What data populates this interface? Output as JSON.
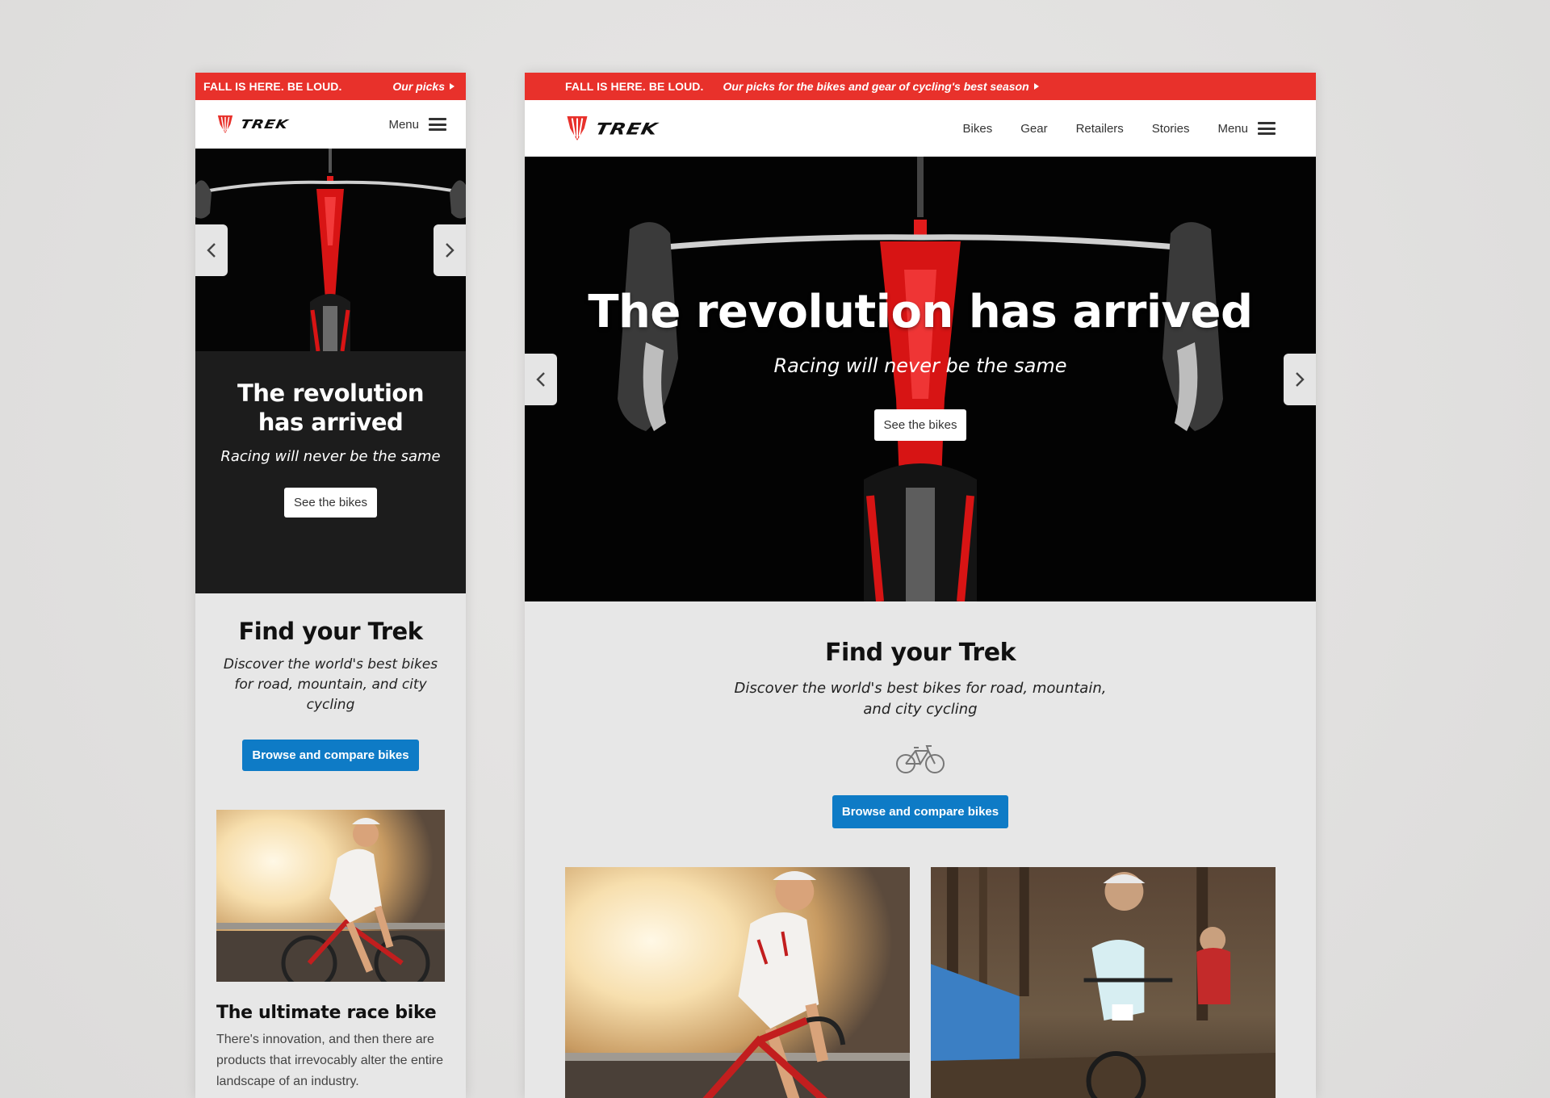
{
  "promo": {
    "lead": "FALL IS HERE. BE LOUD.",
    "link_short": "Our picks",
    "link_long": "Our picks for the bikes and gear of cycling's best season"
  },
  "brand": {
    "name": "TREK",
    "accent": "#e8312b",
    "button_blue": "#0e7bc6"
  },
  "nav": {
    "links": [
      "Bikes",
      "Gear",
      "Retailers",
      "Stories"
    ],
    "menu_label": "Menu"
  },
  "hero": {
    "title": "The revolution has arrived",
    "subtitle": "Racing will never be the same",
    "cta": "See the bikes"
  },
  "find": {
    "title": "Find your Trek",
    "description": "Discover the world's best bikes for road, mountain, and city cycling",
    "cta": "Browse and compare bikes",
    "icon": "bicycle-icon"
  },
  "story": {
    "title": "The ultimate race bike",
    "body": "There's innovation, and then there are products that irrevocably alter the entire landscape of an industry."
  },
  "icons": [
    "trek-logo-icon",
    "hamburger-icon",
    "chevron-left-icon",
    "chevron-right-icon",
    "play-triangle-icon",
    "bicycle-icon"
  ]
}
